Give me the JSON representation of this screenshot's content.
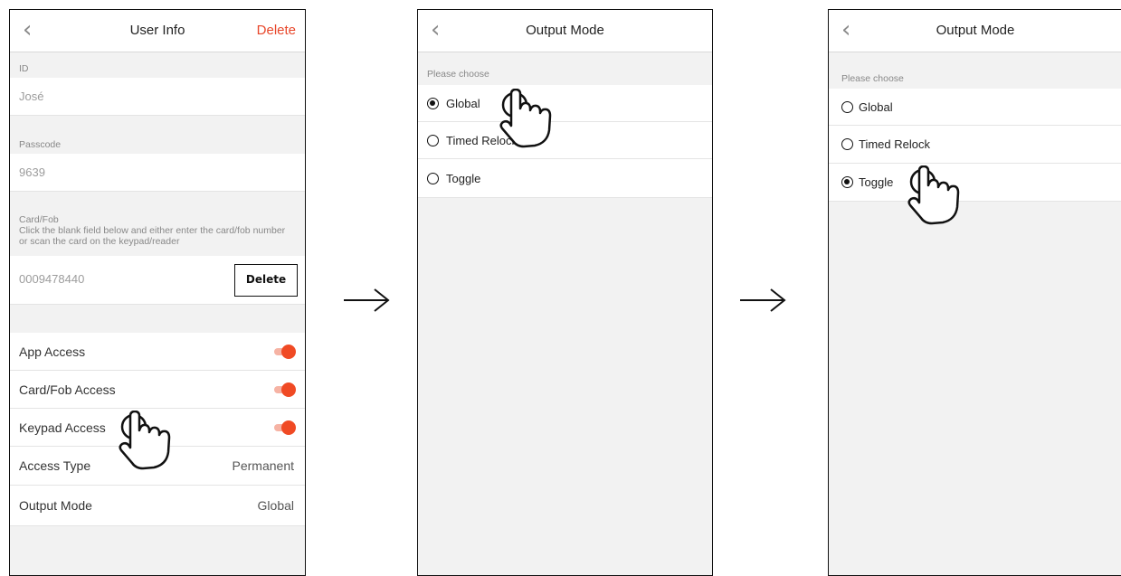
{
  "screen1": {
    "title": "User Info",
    "back_icon": "chevron-left-icon",
    "action_label": "Delete",
    "id_label": "ID",
    "id_value": "José",
    "passcode_label": "Passcode",
    "passcode_value": "9639",
    "card_label": "Card/Fob",
    "card_hint": "Click the blank field below and either enter the card/fob number or scan the card on the keypad/reader",
    "card_value": "0009478440",
    "card_delete_label": "Delete",
    "app_access_label": "App Access",
    "card_access_label": "Card/Fob Access",
    "keypad_access_label": "Keypad Access",
    "access_type_label": "Access Type",
    "access_type_value": "Permanent",
    "output_mode_label": "Output Mode",
    "output_mode_value": "Global",
    "accent": "#f04a24"
  },
  "screen2": {
    "title": "Output Mode",
    "section": "Please choose",
    "options": [
      "Global",
      "Timed Relock",
      "Toggle"
    ],
    "selected": "Global"
  },
  "screen3": {
    "title": "Output Mode",
    "section": "Please choose",
    "options": [
      "Global",
      "Timed Relock",
      "Toggle"
    ],
    "selected": "Toggle"
  },
  "icons": {
    "arrow": "right-arrow-icon",
    "hand": "tap-hand-icon"
  }
}
